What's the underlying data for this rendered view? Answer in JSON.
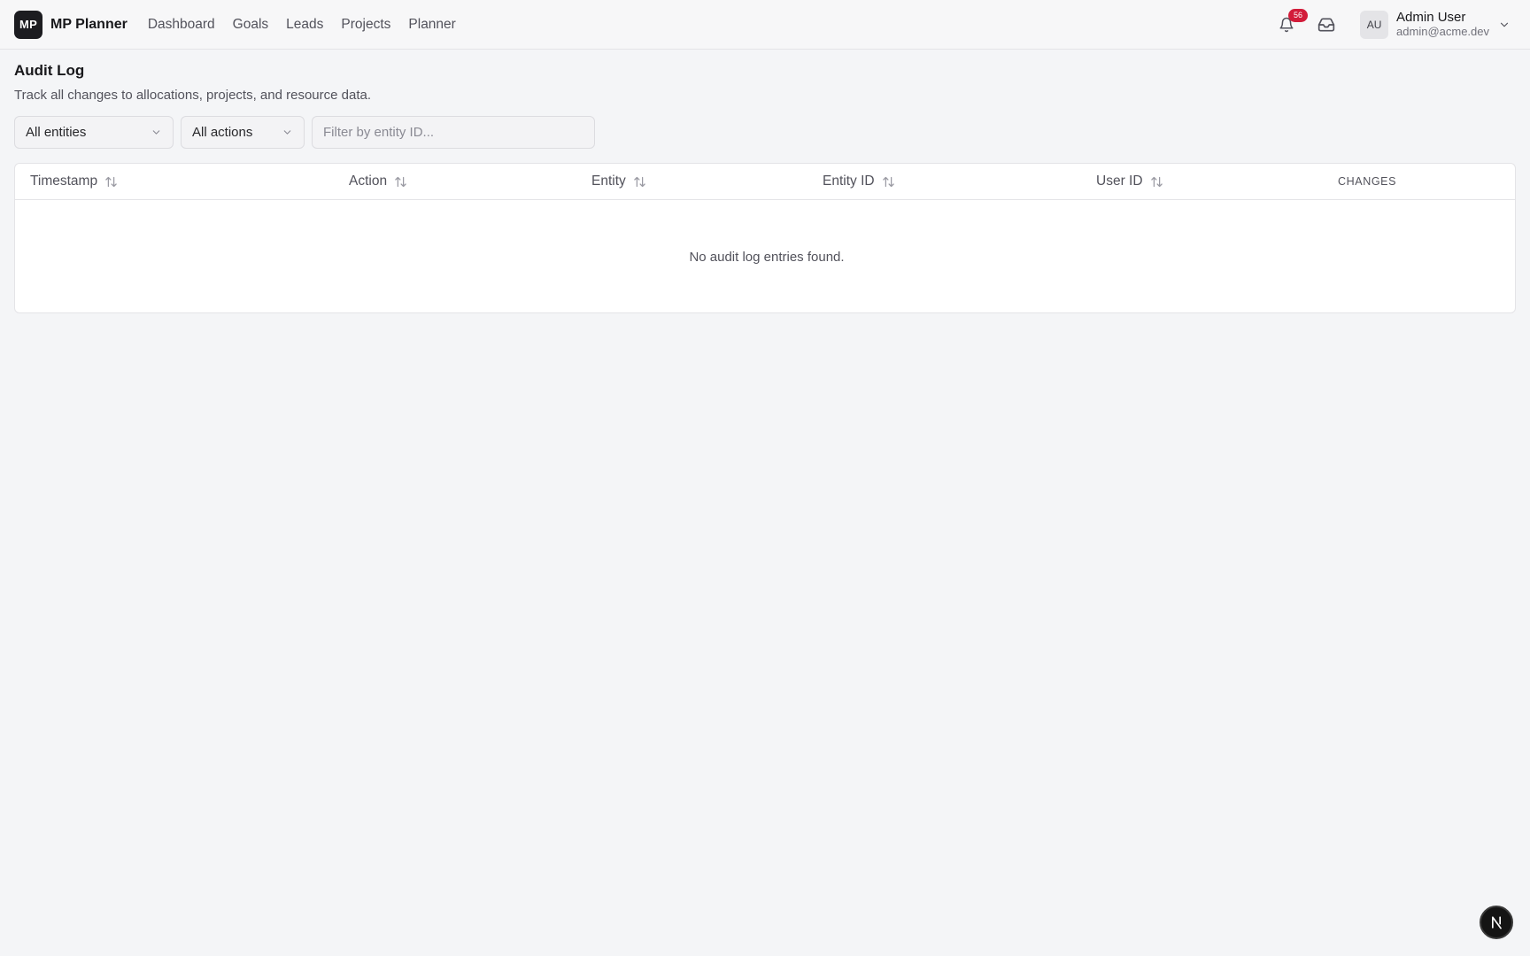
{
  "header": {
    "logo_text": "MP",
    "app_name": "MP Planner",
    "nav": [
      {
        "label": "Dashboard"
      },
      {
        "label": "Goals"
      },
      {
        "label": "Leads"
      },
      {
        "label": "Projects"
      },
      {
        "label": "Planner"
      }
    ],
    "notification_count": "56",
    "user": {
      "initials": "AU",
      "name": "Admin User",
      "email": "admin@acme.dev"
    }
  },
  "page": {
    "title": "Audit Log",
    "subtitle": "Track all changes to allocations, projects, and resource data."
  },
  "filters": {
    "entity_select": "All entities",
    "action_select": "All actions",
    "entity_id_placeholder": "Filter by entity ID..."
  },
  "table": {
    "columns": [
      {
        "label": "Timestamp",
        "sortable": true
      },
      {
        "label": "Action",
        "sortable": true
      },
      {
        "label": "Entity",
        "sortable": true
      },
      {
        "label": "Entity ID",
        "sortable": true
      },
      {
        "label": "User ID",
        "sortable": true
      },
      {
        "label": "CHANGES",
        "sortable": false
      }
    ],
    "empty_message": "No audit log entries found."
  },
  "colors": {
    "badge": "#d21c3a",
    "logo_bg": "#1c1c20",
    "page_bg": "#f4f5f7"
  }
}
